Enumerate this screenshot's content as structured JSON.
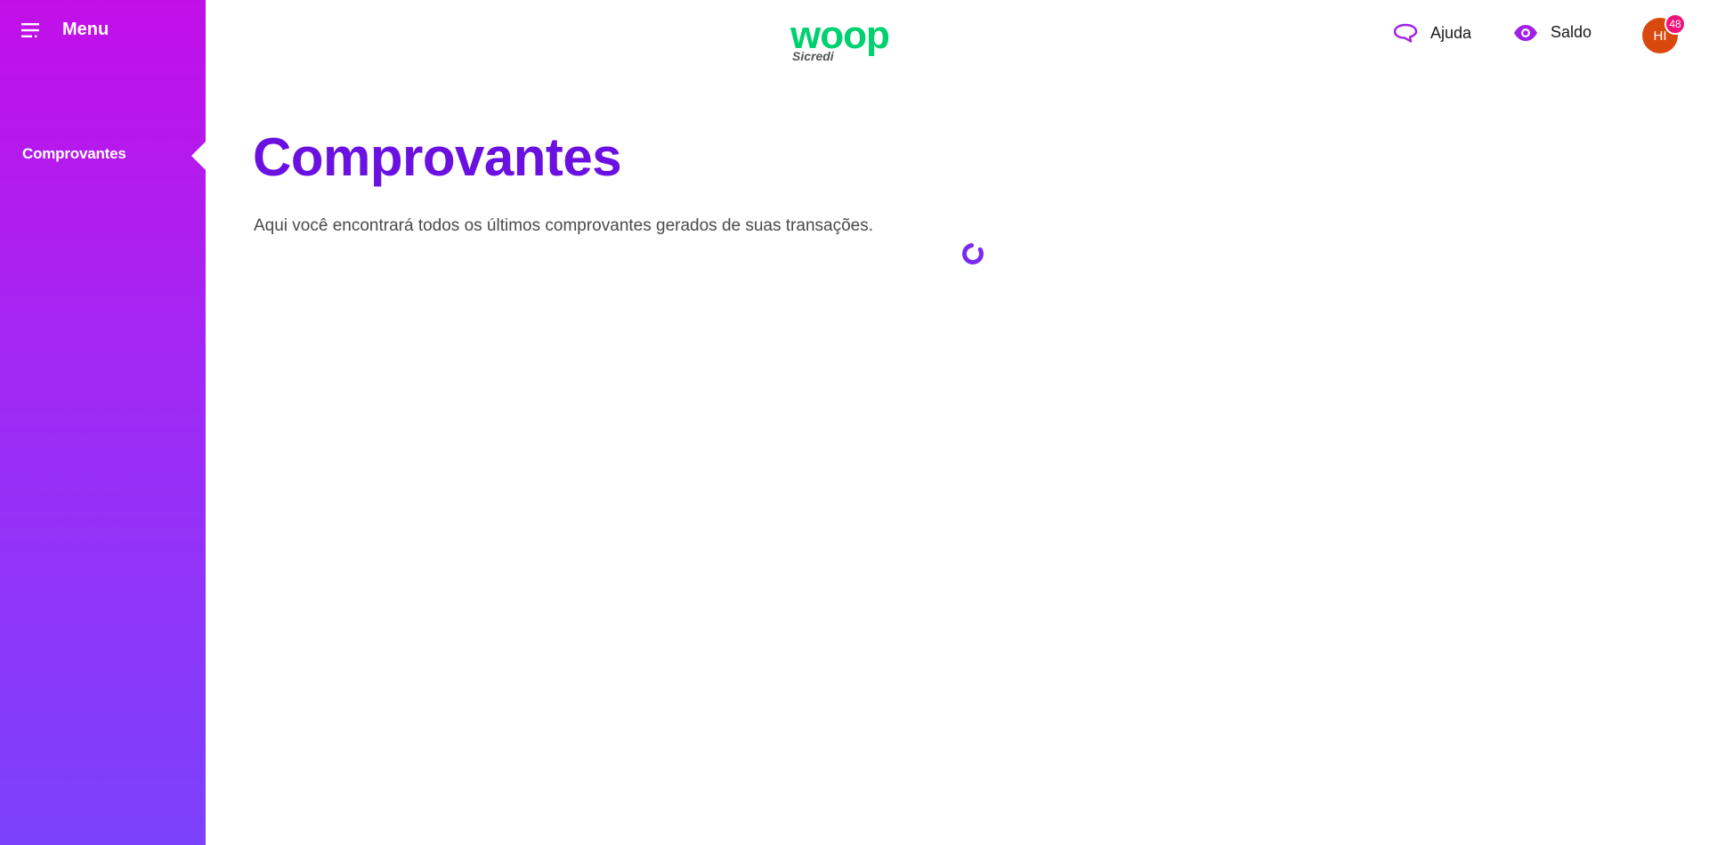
{
  "sidebar": {
    "menu_label": "Menu",
    "items": [
      {
        "label": "Comprovantes",
        "active": true
      }
    ]
  },
  "header": {
    "logo": {
      "brand": "woop",
      "sub": "Sicredi",
      "brand_color": "#00d170"
    },
    "help_label": "Ajuda",
    "balance_label": "Saldo",
    "avatar_initials": "HI",
    "notification_count": "48"
  },
  "main": {
    "title": "Comprovantes",
    "subtitle": "Aqui você encontrará todos os últimos comprovantes gerados de suas transações."
  },
  "colors": {
    "sidebar_top": "#c20fe8",
    "sidebar_bottom": "#7b42fb",
    "title": "#6a10e0",
    "icon_accent": "#a020e8",
    "avatar_bg": "#d9490e",
    "badge_bg": "#f0127a"
  },
  "icons": {
    "menu": "hamburger-icon",
    "help": "chat-bubble-icon",
    "balance": "eye-icon",
    "loading": "spinner-icon"
  }
}
